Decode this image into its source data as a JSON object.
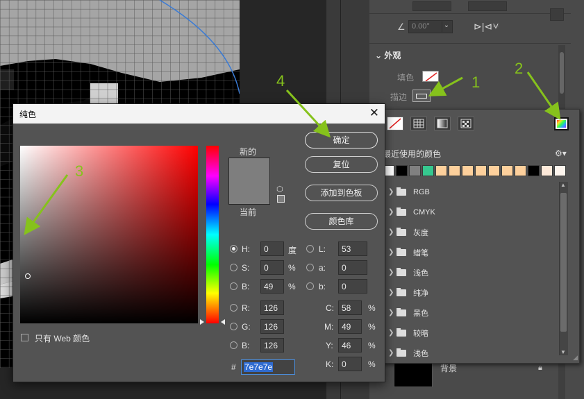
{
  "colors": {
    "new_color": "#7e7e7e",
    "current_color": "#7e7e7e",
    "annotation": "#86c21c"
  },
  "properties": {
    "angle_value": "0.00°",
    "section_title": "外观",
    "fill_label": "填色",
    "stroke_label": "描边",
    "layer_name": "背景"
  },
  "swatch_popup": {
    "tools": [
      "none-swatch-icon",
      "grid-icon",
      "gradient-icon",
      "pattern-icon"
    ],
    "recent_label": "最近使用的颜色",
    "recent_swatches": [
      "#ffffff",
      "#000000",
      "#808080",
      "#36c88f",
      "#fdd09c",
      "#fdd09c",
      "#fdd09c",
      "#fdd09c",
      "#fdd09c",
      "#fdd09c",
      "#fdd09c",
      "#000000",
      "#fde9d9",
      "#fdf5ee"
    ],
    "groups": [
      "RGB",
      "CMYK",
      "灰度",
      "蜡笔",
      "浅色",
      "纯净",
      "黑色",
      "较暗",
      "浅色"
    ]
  },
  "dialog": {
    "title": "纯色",
    "label_new": "新的",
    "label_current": "当前",
    "buttons": {
      "ok": "确定",
      "reset": "复位",
      "add_to_swatches": "添加到色板",
      "color_libraries": "颜色库"
    },
    "fields": {
      "H": {
        "label": "H:",
        "value": "0",
        "unit": "度"
      },
      "S": {
        "label": "S:",
        "value": "0",
        "unit": "%"
      },
      "B": {
        "label": "B:",
        "value": "49",
        "unit": "%"
      },
      "R": {
        "label": "R:",
        "value": "126"
      },
      "G": {
        "label": "G:",
        "value": "126"
      },
      "Bl": {
        "label": "B:",
        "value": "126"
      },
      "L": {
        "label": "L:",
        "value": "53"
      },
      "a": {
        "label": "a:",
        "value": "0"
      },
      "b": {
        "label": "b:",
        "value": "0"
      },
      "C": {
        "label": "C:",
        "value": "58",
        "unit": "%"
      },
      "M": {
        "label": "M:",
        "value": "49",
        "unit": "%"
      },
      "Y": {
        "label": "Y:",
        "value": "46",
        "unit": "%"
      },
      "K": {
        "label": "K:",
        "value": "0",
        "unit": "%"
      }
    },
    "hex_label": "#",
    "hex_value": "7e7e7e",
    "web_only_label": "只有 Web 颜色",
    "selected_mode": "H"
  },
  "annotations": [
    "1",
    "2",
    "3",
    "4"
  ]
}
